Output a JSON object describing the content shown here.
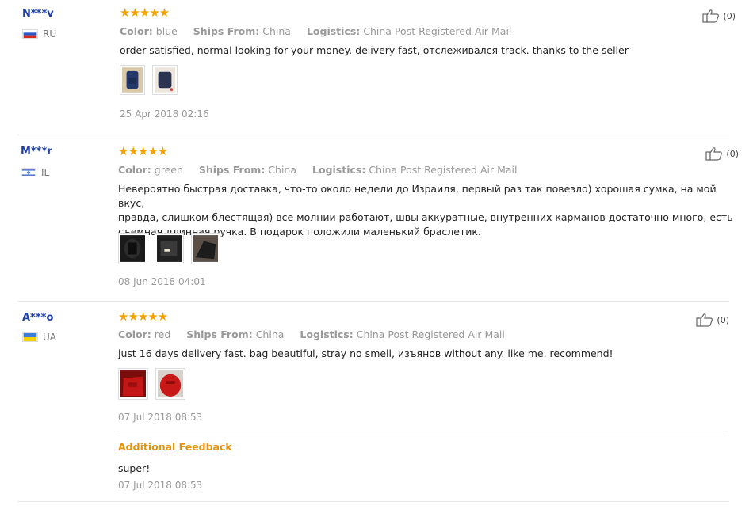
{
  "colors": {
    "name": "#1f3fa6",
    "star": "#f4a200",
    "meta": "#999999",
    "accent": "#e6920a"
  },
  "reviews": [
    {
      "user": "N***v",
      "country_code": "RU",
      "flag": "flag-ru-icon",
      "stars": "★★★★★",
      "color_label": "Color:",
      "color_value": "blue",
      "ships_label": "Ships From:",
      "ships_value": "China",
      "logistics_label": "Logistics:",
      "logistics_value": "China Post Registered Air Mail",
      "text": "order satisfied, normal looking for your money. delivery fast, отслеживался track. thanks to the seller",
      "date": "25 Apr 2018 02:16",
      "helpful": "(0)"
    },
    {
      "user": "M***r",
      "country_code": "IL",
      "flag": "flag-il-icon",
      "stars": "★★★★★",
      "color_label": "Color:",
      "color_value": "green",
      "ships_label": "Ships From:",
      "ships_value": "China",
      "logistics_label": "Logistics:",
      "logistics_value": "China Post Registered Air Mail",
      "text_lines": [
        "Невероятно быстрая доставка, что-то около недели до Израиля, первый раз так повезло) хорошая сумка, на мой вкус,",
        "правда, слишком блестящая) все молнии работают, швы аккуратные, внутренних карманов достаточно много, есть",
        "съемная длинная ручка. В подарок положили маленький браслетик."
      ],
      "date": "08 Jun 2018 04:01",
      "helpful": "(0)"
    },
    {
      "user": "A***o",
      "country_code": "UA",
      "flag": "flag-ua-icon",
      "stars": "★★★★★",
      "color_label": "Color:",
      "color_value": "red",
      "ships_label": "Ships From:",
      "ships_value": "China",
      "logistics_label": "Logistics:",
      "logistics_value": "China Post Registered Air Mail",
      "text": "just 16 days delivery fast. bag beautiful, stray no smell, изъянов without any. like me. recommend!",
      "date": "07 Jul 2018 08:53",
      "helpful": "(0)",
      "additional_label": "Additional Feedback",
      "additional_text": "super!",
      "additional_date": "07 Jul 2018 08:53"
    }
  ]
}
